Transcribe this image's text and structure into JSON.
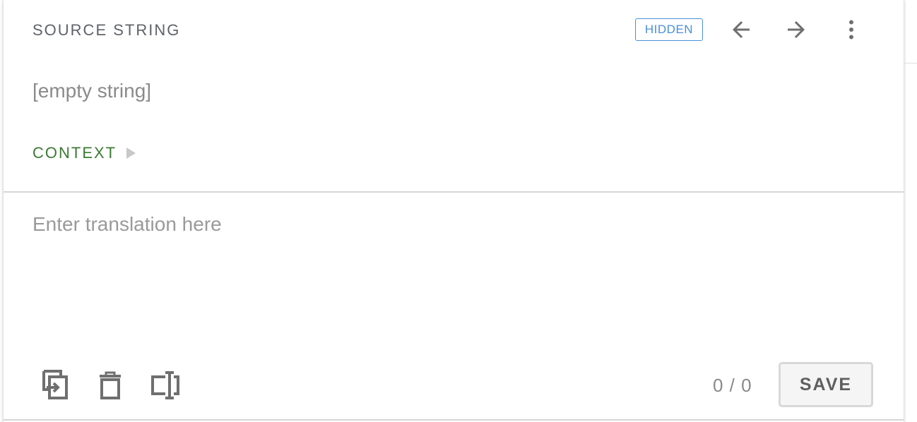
{
  "header": {
    "title": "SOURCE STRING",
    "badge": "HIDDEN",
    "prev_icon": "arrow-left-icon",
    "next_icon": "arrow-right-icon",
    "more_icon": "more-vertical-icon"
  },
  "source": {
    "text": "[empty string]"
  },
  "context": {
    "label": "CONTEXT",
    "icon": "triangle-right-icon"
  },
  "translation": {
    "value": "",
    "placeholder": "Enter translation here"
  },
  "toolbar": {
    "copy_icon": "copy-source-icon",
    "clear_icon": "trash-icon",
    "insert_icon": "insert-placeholder-icon",
    "counter": "0 / 0",
    "save_label": "SAVE"
  },
  "colors": {
    "accent_blue": "#4a90d9",
    "context_green": "#3c7a34",
    "text_gray": "#5f6368",
    "icon_gray": "#6f6f6f"
  }
}
